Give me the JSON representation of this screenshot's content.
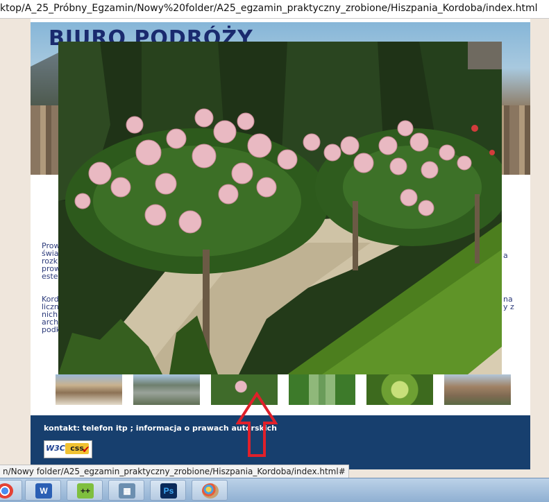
{
  "browser": {
    "address_bar": "ktop/A_25_Próbny_Egzamin/Nowy%20folder/A25_egzamin_praktyczny_zrobione/Hiszpania_Kordoba/index.html",
    "status_url": "n/Nowy folder/A25_egzamin_praktyczny_zrobione/Hiszpania_Kordoba/index.html#"
  },
  "page": {
    "title": "BIURO PODRÓŻY",
    "left_text_1": [
      "Prow",
      "świa",
      "rozk",
      "prow",
      "este"
    ],
    "left_text_2": [
      "Kord",
      "liczn",
      "nich",
      "arch",
      "podk"
    ],
    "right_text_1": [
      "",
      "a",
      "",
      "",
      ""
    ],
    "right_text_2": [
      "na",
      "y z",
      "",
      "",
      ""
    ],
    "footer_text": "kontakt: telefon itp ; informacja o prawach autorskich",
    "badge_w3c": "W3C",
    "badge_css": "css",
    "thumbnails": [
      "thumbnail-1",
      "thumbnail-2",
      "thumbnail-3",
      "thumbnail-4",
      "thumbnail-5",
      "thumbnail-6"
    ]
  },
  "taskbar": {
    "apps": [
      "chrome",
      "word",
      "notepad-plus-plus",
      "calculator",
      "photoshop",
      "paint"
    ],
    "photoshop_label": "Ps",
    "word_label": "W"
  },
  "colors": {
    "title": "#1a2a6e",
    "footer": "#173f6e",
    "arrow": "#e0202a"
  }
}
